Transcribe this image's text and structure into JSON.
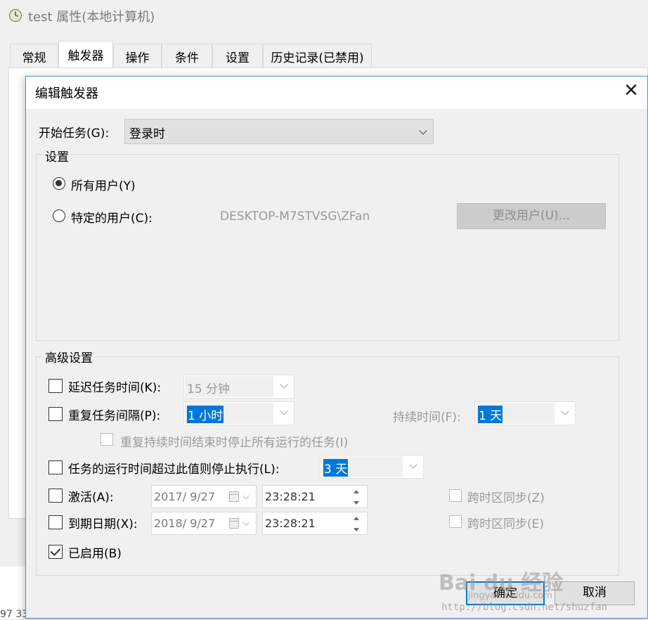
{
  "background_window": {
    "title": "test 属性(本地计算机)",
    "tabs": [
      "常规",
      "触发器",
      "操作",
      "条件",
      "设置",
      "历史记录(已禁用)"
    ],
    "active_tab": "触发器",
    "clipped_text": "97 33"
  },
  "dialog": {
    "title": "编辑触发器",
    "start_task": {
      "label": "开始任务(G):",
      "value": "登录时"
    },
    "settings": {
      "title": "设置",
      "all_users_label": "所有用户(Y)",
      "specific_user_label": "特定的用户(C):",
      "user_name": "DESKTOP-M7STVSG\\ZFan",
      "change_user_button": "更改用户(U)...",
      "selected": "all_users"
    },
    "advanced": {
      "title": "高级设置",
      "delay": {
        "label": "延迟任务时间(K):",
        "value": "15 分钟",
        "checked": false
      },
      "repeat": {
        "label": "重复任务间隔(P):",
        "value": "1 小时",
        "checked": false,
        "duration_label": "持续时间(F):",
        "duration_value": "1 天"
      },
      "stop_all": {
        "label": "重复持续时间结束时停止所有运行的任务(I)",
        "checked": false
      },
      "stop_if": {
        "label": "任务的运行时间超过此值则停止执行(L):",
        "value": "3 天",
        "checked": false
      },
      "activate": {
        "label": "激活(A):",
        "date": "2017/  9/27",
        "time": "23:28:21",
        "checked": false,
        "sync_label": "跨时区同步(Z)"
      },
      "expire": {
        "label": "到期日期(X):",
        "date": "2018/  9/27",
        "time": "23:28:21",
        "checked": false,
        "sync_label": "跨时区同步(E)"
      },
      "enabled": {
        "label": "已启用(B)",
        "checked": true
      }
    },
    "buttons": {
      "ok": "确定",
      "cancel": "取消"
    }
  },
  "watermark": {
    "brand": "Bai du 经验",
    "sub": "jingyan.baidu.com",
    "url": "http://blog.csdn.net/shuzfan"
  }
}
